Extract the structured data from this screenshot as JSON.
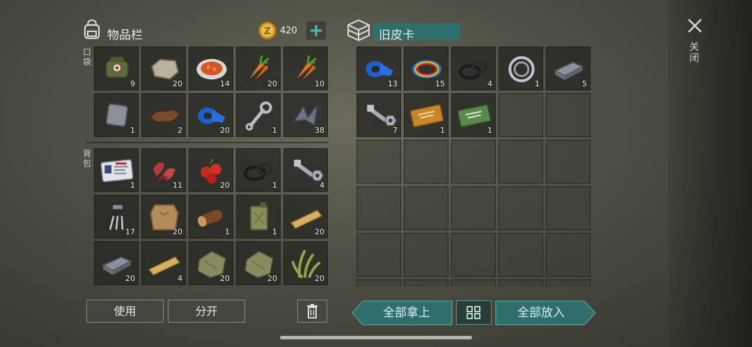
{
  "inventory": {
    "title": "物品栏",
    "currency_amount": "420",
    "pockets_label": "口袋",
    "backpack_label": "背包",
    "pockets": [
      {
        "icon": "medkit-bag-icon",
        "count": "9"
      },
      {
        "icon": "stone-icon",
        "count": "20"
      },
      {
        "icon": "food-plate-icon",
        "count": "14"
      },
      {
        "icon": "carrot-icon",
        "count": "20"
      },
      {
        "icon": "carrot-icon",
        "count": "10"
      },
      {
        "icon": "metal-plate-icon",
        "count": "1"
      },
      {
        "icon": "leather-icon",
        "count": "2"
      },
      {
        "icon": "blue-tape-icon",
        "count": "20"
      },
      {
        "icon": "wrench-icon",
        "count": "1"
      },
      {
        "icon": "metal-scrap-icon",
        "count": "38"
      }
    ],
    "backpack": [
      {
        "icon": "id-card-icon",
        "count": "1"
      },
      {
        "icon": "raw-meat-icon",
        "count": "11"
      },
      {
        "icon": "berries-icon",
        "count": "20"
      },
      {
        "icon": "rubber-ring-icon",
        "count": "1"
      },
      {
        "icon": "bolt-nut-icon",
        "count": "4"
      },
      {
        "icon": "transistor-icon",
        "count": "17"
      },
      {
        "icon": "animal-hide-icon",
        "count": "20"
      },
      {
        "icon": "log-icon",
        "count": "1"
      },
      {
        "icon": "jerrycan-icon",
        "count": "1"
      },
      {
        "icon": "plank-icon",
        "count": "20"
      },
      {
        "icon": "iron-bar-icon",
        "count": "20"
      },
      {
        "icon": "plank-icon",
        "count": "4"
      },
      {
        "icon": "cloth-icon",
        "count": "20"
      },
      {
        "icon": "cloth-icon",
        "count": "20"
      },
      {
        "icon": "plant-fiber-icon",
        "count": "20"
      }
    ]
  },
  "container": {
    "title": "旧皮卡",
    "items": [
      {
        "icon": "blue-tape-icon",
        "count": "13"
      },
      {
        "icon": "wires-icon",
        "count": "15"
      },
      {
        "icon": "rubber-ring-icon",
        "count": "4"
      },
      {
        "icon": "bearing-icon",
        "count": "1"
      },
      {
        "icon": "iron-bar-icon",
        "count": "5"
      },
      {
        "icon": "bolt-nut-icon",
        "count": "7"
      },
      {
        "icon": "coupon-orange-icon",
        "count": "1"
      },
      {
        "icon": "coupon-green-icon",
        "count": "1"
      }
    ]
  },
  "buttons": {
    "use": "使用",
    "split": "分开",
    "take_all": "全部拿上",
    "put_all": "全部放入",
    "close": "关闭"
  },
  "colors": {
    "accent_teal": "#2f6e6a",
    "bg": "#4f4e44"
  }
}
